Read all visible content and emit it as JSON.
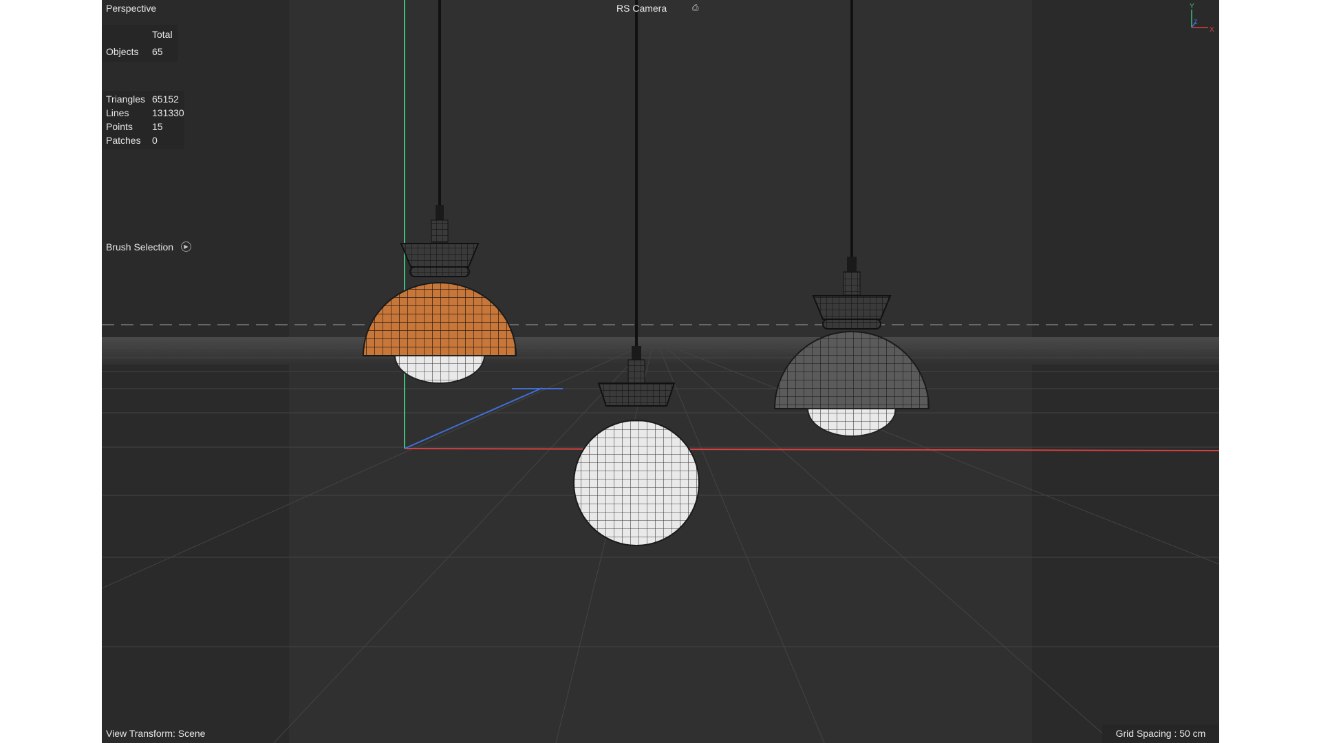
{
  "viewport": {
    "view_name": "Perspective",
    "camera_label": "RS Camera",
    "camera_icon": "camera-lock-icon",
    "stats_total": {
      "header": "Total",
      "objects_label": "Objects",
      "objects_value": "65"
    },
    "stats_geometry": [
      {
        "label": "Triangles",
        "value": "65152"
      },
      {
        "label": "Lines",
        "value": "131330"
      },
      {
        "label": "Points",
        "value": "15"
      },
      {
        "label": "Patches",
        "value": "0"
      }
    ],
    "brush_selection": "Brush Selection",
    "brush_icon": "play-circle-icon",
    "view_transform": "View Transform: Scene",
    "grid_spacing": "Grid Spacing : 50 cm",
    "axis_labels": {
      "y": "Y",
      "z": "Z",
      "x": "X"
    }
  },
  "colors": {
    "background": "#303030",
    "x_axis": "#d94040",
    "y_axis": "#3cc07a",
    "z_axis": "#3f6fd6",
    "lamp_orange": "#c8773a",
    "lamp_white": "#e6e6e6",
    "lamp_grey": "#5a5a5a"
  }
}
